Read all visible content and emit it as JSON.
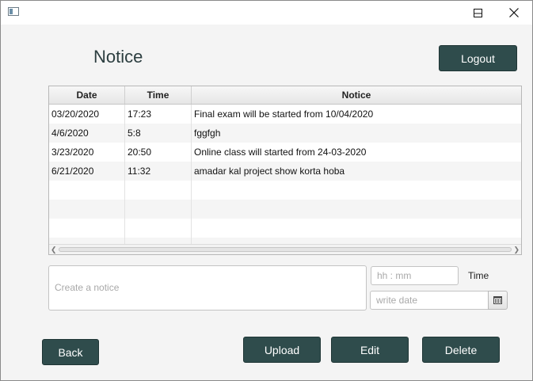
{
  "window": {
    "icon": "app-window-icon",
    "controls": {
      "minimize": "minimize-icon",
      "maximize": "maximize-icon",
      "close": "close-icon"
    }
  },
  "header": {
    "title": "Notice",
    "logout_label": "Logout"
  },
  "table": {
    "columns": [
      "Date",
      "Time",
      "Notice"
    ],
    "rows": [
      {
        "date": "03/20/2020",
        "time": "17:23",
        "notice": "Final exam will be started from 10/04/2020"
      },
      {
        "date": "4/6/2020",
        "time": "5:8",
        "notice": "fggfgh"
      },
      {
        "date": "3/23/2020",
        "time": "20:50",
        "notice": "Online class will started from 24-03-2020"
      },
      {
        "date": "6/21/2020",
        "time": "11:32",
        "notice": "amadar kal project show korta hoba"
      }
    ]
  },
  "form": {
    "notice_placeholder": "Create a notice",
    "time_placeholder": "hh : mm",
    "time_label": "Time",
    "date_placeholder": "write date",
    "calendar_icon": "calendar-icon"
  },
  "actions": {
    "back": "Back",
    "upload": "Upload",
    "edit": "Edit",
    "delete": "Delete"
  },
  "colors": {
    "button": "#2f4c4c",
    "background": "#f4f4f4"
  }
}
